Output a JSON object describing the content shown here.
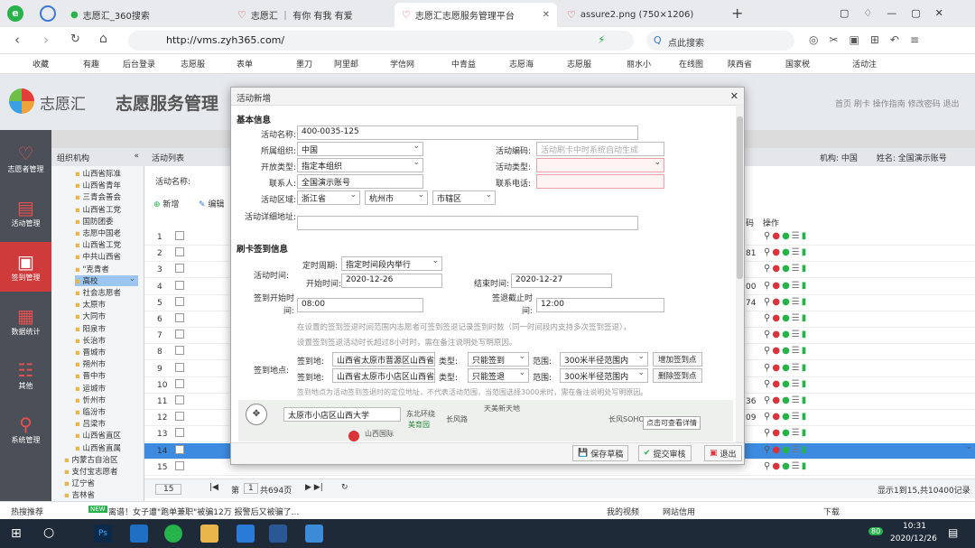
{
  "browser": {
    "tabs": [
      {
        "title": "志愿汇_360搜索",
        "active": false
      },
      {
        "title": "志愿汇 ｜ 有你 有我 有爱",
        "active": false
      },
      {
        "title": "志愿汇志愿服务管理平台",
        "active": true
      },
      {
        "title": "assure2.png (750×1206)",
        "active": false
      }
    ],
    "url": "http://vms.zyh365.com/",
    "search_placeholder": "点此搜索",
    "bookmarks": [
      "收藏",
      "有趣",
      "后台登录",
      "志愿服",
      "表单",
      "墨刀",
      "阿里邮",
      "学信网",
      "中青益",
      "志愿海",
      "志愿服",
      "丽水小",
      "在线图",
      "陕西省",
      "国家税",
      "活动注"
    ]
  },
  "app": {
    "brand": "志愿汇",
    "title": "志愿服务管理",
    "header_links": "首页 刷卡 操作指南 修改密码 退出",
    "org_label": "机构:",
    "org_value": "中国",
    "name_label": "姓名:",
    "name_value": "全国演示账号",
    "sidebar": [
      {
        "label": "志愿者管理",
        "active": false
      },
      {
        "label": "活动管理",
        "active": false
      },
      {
        "label": "签到管理",
        "active": true
      },
      {
        "label": "数据统计",
        "active": false
      },
      {
        "label": "其他",
        "active": false
      },
      {
        "label": "系统管理",
        "active": false
      }
    ],
    "tree_title": "组织机构",
    "tree": [
      "山西省际准",
      "山西省青年",
      "三青会善会",
      "山西省工党",
      "国防团委",
      "志愿中国老",
      "山西省工党",
      "中共山西省",
      "\"克青者",
      "高校",
      "社会志愿者",
      "太原市",
      "大同市",
      "阳泉市",
      "长治市",
      "晋城市",
      "朔州市",
      "晋中市",
      "运城市",
      "忻州市",
      "临汾市",
      "吕梁市",
      "山西省直区",
      "山西省直属",
      "内蒙古自治区",
      "支付宝志愿者",
      "辽宁省",
      "吉林省"
    ],
    "list_title": "活动列表",
    "list_search_label": "活动名称:",
    "toolbar_new": "新增",
    "toolbar_edit": "编辑",
    "col_ops": "操作",
    "col_code": "码",
    "rows": [
      "1",
      "2",
      "3",
      "4",
      "5",
      "6",
      "7",
      "8",
      "9",
      "10",
      "11",
      "12",
      "13",
      "14",
      "15"
    ],
    "row_codes": [
      "",
      "81",
      "",
      "00",
      "74",
      "",
      "",
      "",
      "",
      "",
      "36",
      "09",
      "",
      "",
      ""
    ],
    "pager_size": "15",
    "pager_page": "第",
    "pager_page_num": "1",
    "pager_total_pages": "共694页",
    "pager_summary": "显示1到15,共10400记录"
  },
  "modal": {
    "title": "活动新增",
    "section_basic": "基本信息",
    "name_label": "活动名称:",
    "name_value": "400-0035-125",
    "org_label": "所属组织:",
    "org_value": "中国",
    "code_label": "活动编码:",
    "code_placeholder": "活动刷卡中时系统自动生成",
    "open_label": "开放类型:",
    "open_value": "指定本组织",
    "type_label": "活动类型:",
    "type_value": "",
    "contact_label": "联系人:",
    "contact_value": "全国演示账号",
    "phone_label": "联系电话:",
    "phone_value": "",
    "region_label": "活动区域:",
    "province": "浙江省",
    "city": "杭州市",
    "district": "市辖区",
    "address_label": "活动详细地址:",
    "address_value": "",
    "section_sign": "刷卡签到信息",
    "period_label": "定时周期:",
    "period_value": "指定时间段内举行",
    "time_label": "活动时间:",
    "start_label": "开始时间:",
    "start_value": "2020-12-26",
    "end_label": "结束时间:",
    "end_value": "2020-12-27",
    "signstart_label": "签到开始时间:",
    "signstart_value": "08:00",
    "signend_label": "签退截止时间:",
    "signend_value": "12:00",
    "hint1": "在设置的签到签退时间范围内志愿者可签到签退记录签到时数（同一时间段内支持多次签到签退），",
    "hint2": "设置签到签退活动时长超过8小时时，需在备注说明处写明原因。",
    "place_label": "签到地点:",
    "places": [
      {
        "label": "签到地:",
        "value": "山西省太原市晋源区山西省",
        "type_label": "类型:",
        "type": "只能签到",
        "range_label": "范围:",
        "range": "300米半径范围内",
        "action": "增加签到点"
      },
      {
        "label": "签到地:",
        "value": "山西省太原市小店区山西省",
        "type_label": "类型:",
        "type": "只能签退",
        "range_label": "范围:",
        "range": "300米半径范围内",
        "action": "删除签到点"
      }
    ],
    "hint3": "签到地点为活动签到签退时的定位地址，不代表活动范围，当范围选择3000米时，需在备注说明处写明原因。",
    "map_search": "太原市小店区山西大学",
    "map_tip": "点击可查看详情",
    "map_labels": [
      "东北环绕",
      "天美新天地",
      "长风SOHO",
      "长风路",
      "美育园",
      "山西国际"
    ],
    "btn_save": "保存草稿",
    "btn_submit": "提交审核",
    "btn_exit": "退出"
  },
  "status": {
    "news_tag": "热搜推荐",
    "news_text": "离谱！女子遭\"跑单兼职\"被骗12万 报警后又被骗了...",
    "video": "我的视频",
    "credit": "网站信用",
    "download": "下载"
  },
  "taskbar": {
    "time": "10:31",
    "date": "2020/12/26",
    "badge": "80"
  },
  "colors": {
    "accent": "#cf3a3a",
    "brand": "#d8343a",
    "select": "#3d8be0"
  }
}
